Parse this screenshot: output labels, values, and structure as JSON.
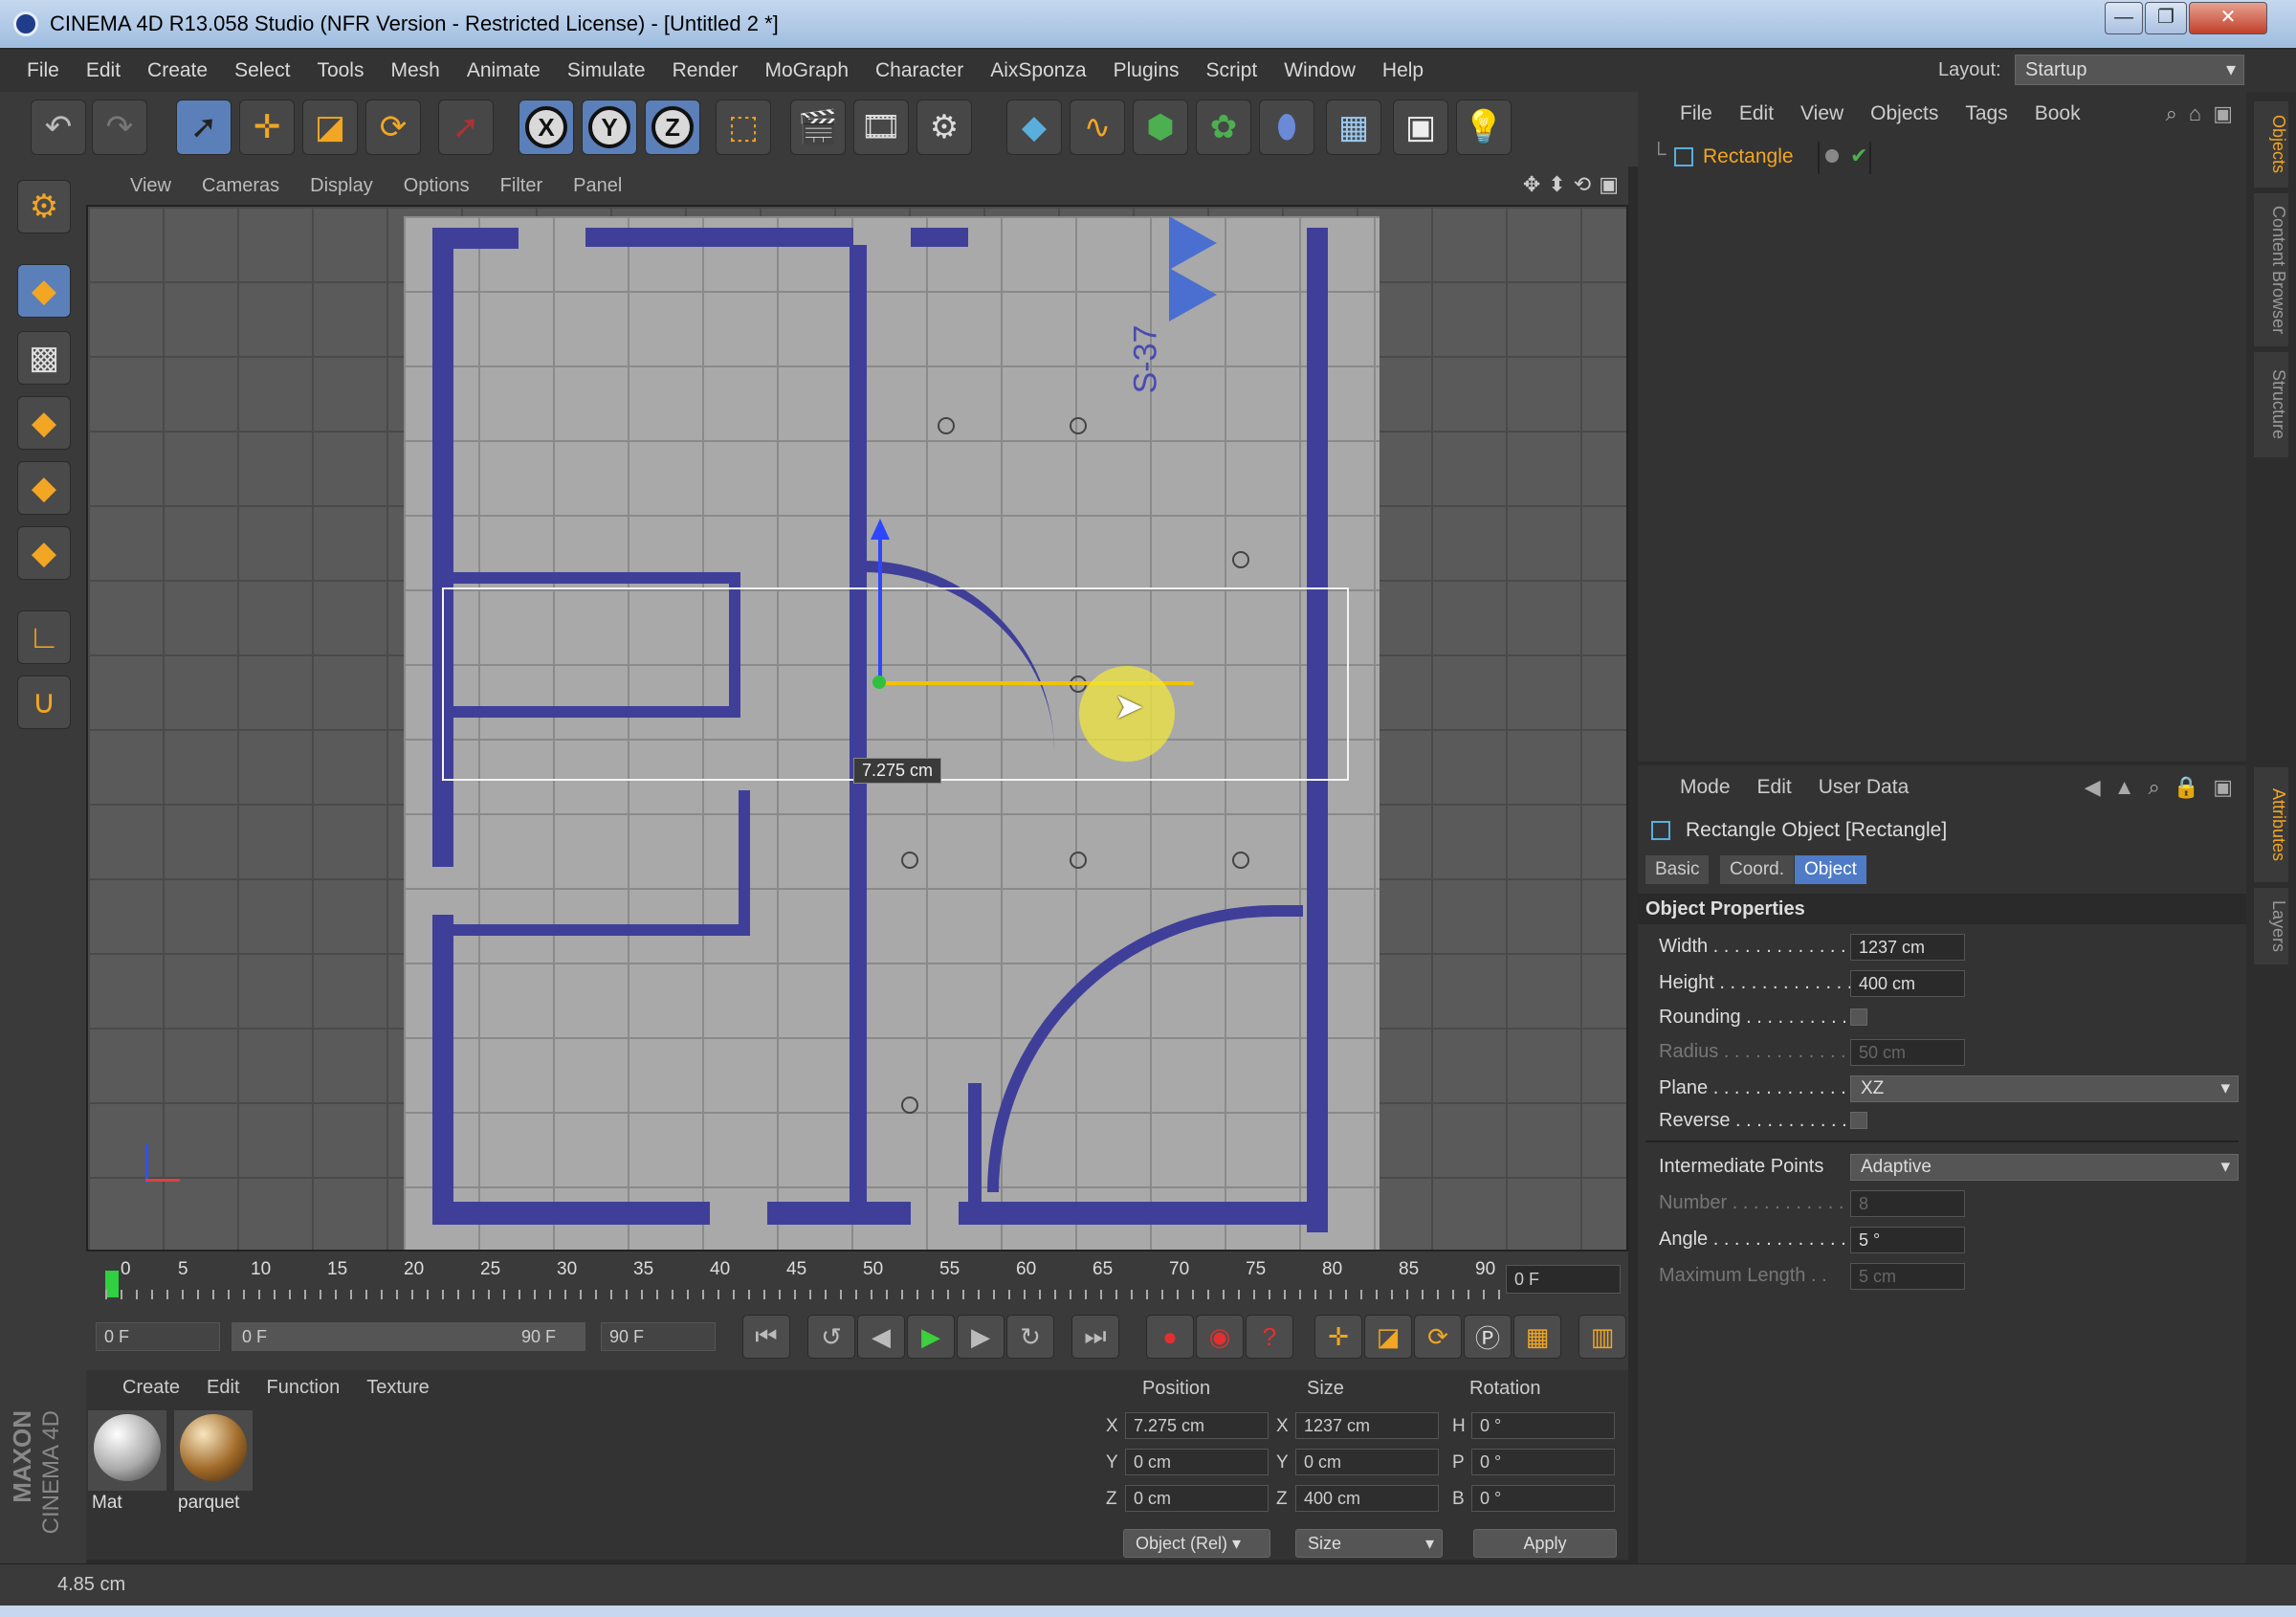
{
  "window": {
    "title": "CINEMA 4D R13.058 Studio (NFR Version - Restricted License) - [Untitled 2 *]",
    "buttons": [
      "—",
      "❐",
      "✕"
    ]
  },
  "menubar": {
    "items": [
      "File",
      "Edit",
      "Create",
      "Select",
      "Tools",
      "Mesh",
      "Animate",
      "Simulate",
      "Render",
      "MoGraph",
      "Character",
      "AixSponza",
      "Plugins",
      "Script",
      "Window",
      "Help"
    ],
    "layout_label": "Layout:",
    "layout_value": "Startup"
  },
  "toolbar": {
    "axis_x": "X",
    "axis_y": "Y",
    "axis_z": "Z"
  },
  "viewport": {
    "menu": [
      "View",
      "Cameras",
      "Display",
      "Options",
      "Filter",
      "Panel"
    ],
    "plan_label": "S-37",
    "tooltip": "7.275 cm"
  },
  "timeline": {
    "ticks": [
      "0",
      "5",
      "10",
      "15",
      "20",
      "25",
      "30",
      "35",
      "40",
      "45",
      "50",
      "55",
      "60",
      "65",
      "70",
      "75",
      "80",
      "85",
      "90"
    ],
    "current_frame": "0 F"
  },
  "transport": {
    "start_field": "0 F",
    "range_start": "0 F",
    "range_end": "90 F",
    "end_field": "90 F"
  },
  "material_manager": {
    "menu": [
      "Create",
      "Edit",
      "Function",
      "Texture"
    ],
    "materials": [
      "Mat",
      "parquet"
    ],
    "brand_top": "MAXON",
    "brand_bottom": "CINEMA 4D"
  },
  "coordinates": {
    "headers": {
      "position": "Position",
      "size": "Size",
      "rotation": "Rotation"
    },
    "rows": [
      {
        "axis": "X",
        "pos": "7.275 cm",
        "size_axis": "X",
        "size": "1237 cm",
        "rot_axis": "H",
        "rot": "0 °"
      },
      {
        "axis": "Y",
        "pos": "0 cm",
        "size_axis": "Y",
        "size": "0 cm",
        "rot_axis": "P",
        "rot": "0 °"
      },
      {
        "axis": "Z",
        "pos": "0 cm",
        "size_axis": "Z",
        "size": "400 cm",
        "rot_axis": "B",
        "rot": "0 °"
      }
    ],
    "mode_select": "Object (Rel)",
    "size_select": "Size",
    "apply": "Apply"
  },
  "object_manager": {
    "menu": [
      "File",
      "Edit",
      "View",
      "Objects",
      "Tags",
      "Book"
    ],
    "object_name": "Rectangle"
  },
  "attribute_manager": {
    "menu": [
      "Mode",
      "Edit",
      "User Data"
    ],
    "object_title": "Rectangle Object [Rectangle]",
    "tabs": [
      "Basic",
      "Coord.",
      "Object"
    ],
    "section": "Object Properties",
    "width_label": "Width . . . . . . . . . . . . . .",
    "width": "1237 cm",
    "height_label": "Height . . . . . . . . . . . . . .",
    "height": "400 cm",
    "rounding_label": "Rounding . . . . . . . . . . .",
    "radius_label": "Radius . . . . . . . . . . . . . .",
    "radius": "50 cm",
    "plane_label": "Plane . . . . . . . . . . . . . .",
    "plane": "XZ",
    "reverse_label": "Reverse . . . . . . . . . . . .",
    "intermediate_label": "Intermediate Points",
    "intermediate": "Adaptive",
    "number_label": "Number . . . . . . . . . . . . .",
    "number": "8",
    "angle_label": "Angle . . . . . . . . . . . . . .",
    "angle": "5 °",
    "maxlen_label": "Maximum Length . .",
    "maxlen": "5 cm"
  },
  "side_tabs": [
    "Objects",
    "Content Browser",
    "Structure",
    "Attributes",
    "Layers"
  ],
  "status": "4.85 cm"
}
